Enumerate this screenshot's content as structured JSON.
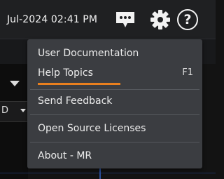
{
  "header": {
    "datetime": "Jul-2024 02:41 PM"
  },
  "icons": {
    "feedback": "chat-bubble-icon",
    "settings": "gear-icon",
    "help": "help-circle-icon"
  },
  "help_glyph": "?",
  "left_panel": {
    "strip_text": "D"
  },
  "menu": {
    "items": [
      {
        "label": "User Documentation",
        "shortcut": ""
      },
      {
        "label": "Help Topics",
        "shortcut": "F1"
      },
      {
        "label": "Send Feedback",
        "shortcut": ""
      },
      {
        "label": "Open Source Licenses",
        "shortcut": ""
      },
      {
        "label": "About - MR",
        "shortcut": ""
      }
    ],
    "highlight_color": "#e87f1e"
  }
}
